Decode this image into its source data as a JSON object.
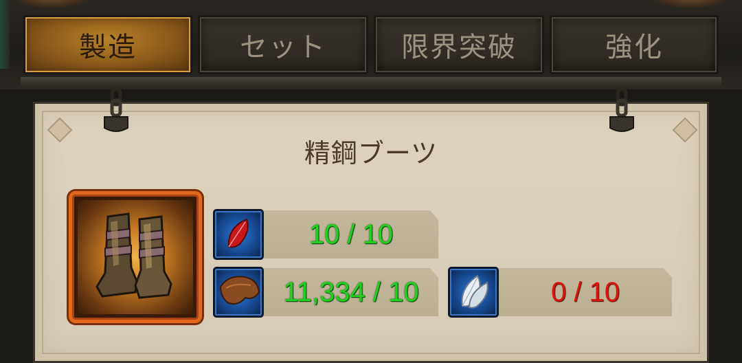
{
  "tabs": [
    {
      "label": "製造",
      "active": true
    },
    {
      "label": "セット",
      "active": false
    },
    {
      "label": "限界突破",
      "active": false
    },
    {
      "label": "強化",
      "active": false
    }
  ],
  "item": {
    "name": "精鋼ブーツ",
    "icon": "steel-boots-icon",
    "rarity_color": "#e2691c"
  },
  "materials": [
    {
      "icon": "red-feather-icon",
      "count": "10 / 10",
      "status": "sufficient"
    },
    {
      "icon": "leather-hide-icon",
      "count": "11,334 / 10",
      "status": "sufficient"
    },
    {
      "icon": "white-feather-icon",
      "count": "0 / 10",
      "status": "insufficient"
    }
  ],
  "colors": {
    "sufficient": "#22d01e",
    "insufficient": "#d8160e",
    "active_tab": "#b8822a",
    "panel_bg": "#ddd3bd"
  }
}
